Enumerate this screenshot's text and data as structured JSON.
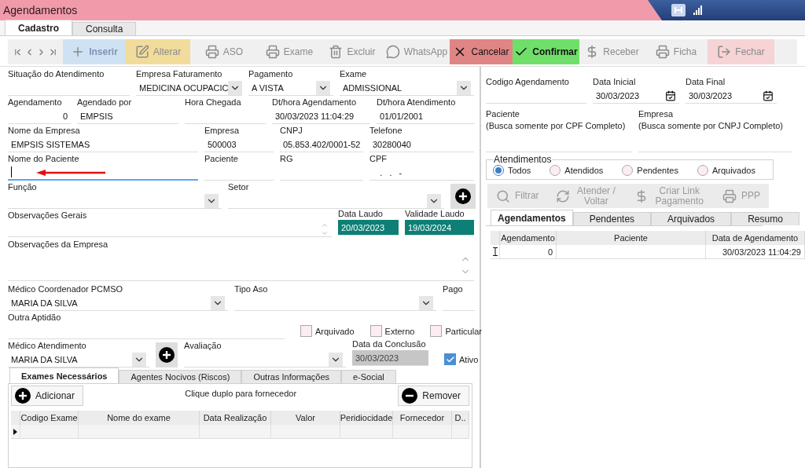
{
  "window": {
    "title": "Agendamentos"
  },
  "tabs": [
    {
      "label": "Cadastro",
      "selected": true
    },
    {
      "label": "Consulta",
      "selected": false
    }
  ],
  "toolbar": [
    {
      "label": "Inserir",
      "kind": "primary",
      "color": "#cfe2f3",
      "disabled": true
    },
    {
      "label": "Alterar",
      "kind": "normal",
      "color": "#f2dc9b",
      "disabled": true
    },
    {
      "label": "ASO",
      "kind": "normal",
      "disabled": true
    },
    {
      "label": "Exame",
      "kind": "normal",
      "disabled": true
    },
    {
      "label": "Excluir",
      "kind": "normal",
      "disabled": true
    },
    {
      "label": "WhatsApp",
      "kind": "normal",
      "disabled": true
    },
    {
      "label": "Cancelar",
      "kind": "normal",
      "color": "#e08585",
      "disabled": false
    },
    {
      "label": "Confirmar",
      "kind": "primary",
      "color": "#70df6a",
      "disabled": false
    },
    {
      "label": "Receber",
      "kind": "normal",
      "disabled": true
    },
    {
      "label": "Ficha",
      "kind": "normal",
      "disabled": true
    },
    {
      "label": "Fechar",
      "kind": "normal",
      "color": "#f6d3d5",
      "disabled": true
    }
  ],
  "form": [
    [
      {
        "label": "Situação do Atendimento",
        "kind": "text",
        "focused": false
      },
      {
        "label": "Empresa Faturamento",
        "value": "MEDICINA OCUPACIC",
        "kind": "select",
        "focused": false
      },
      {
        "label": "Pagamento",
        "value": "A VISTA",
        "kind": "select",
        "focused": false
      },
      {
        "label": "Exame",
        "value": "ADMISSIONAL",
        "kind": "select",
        "focused": false
      }
    ],
    [
      {
        "label": "Agendamento",
        "value": "0",
        "kind": "number",
        "focused": false
      },
      {
        "label": "Agendado por",
        "value": "EMPSIS",
        "kind": "text",
        "focused": false
      },
      {
        "label": "Hora Chegada",
        "kind": "text",
        "focused": false
      },
      {
        "label": "Dt/hora Agendamento",
        "value": "30/03/2023 11:04:29",
        "kind": "text",
        "focused": false
      },
      {
        "label": "Dt/hora Atendimento",
        "value": "01/01/2001",
        "kind": "text",
        "focused": false
      }
    ],
    [
      {
        "label": "Nome da Empresa",
        "value": "EMPSIS SISTEMAS",
        "kind": "text",
        "focused": false
      },
      {
        "label": "Empresa",
        "value": "500003",
        "kind": "text",
        "focused": false
      },
      {
        "label": "CNPJ",
        "value": "05.853.402/0001-52",
        "kind": "text",
        "focused": false
      },
      {
        "label": "Telefone",
        "value": "30280040",
        "kind": "text",
        "focused": false
      }
    ],
    [
      {
        "label": "Nome do Paciente",
        "kind": "text",
        "focused": true
      },
      {
        "label": "Paciente",
        "kind": "text",
        "focused": false
      },
      {
        "label": "RG",
        "kind": "text",
        "focused": false
      },
      {
        "label": "CPF",
        "value": "   .   .   -",
        "kind": "text",
        "focused": false
      }
    ],
    [
      {
        "label": "Função",
        "kind": "select",
        "focused": false
      },
      {
        "label": "Setor",
        "kind": "select",
        "focused": false
      },
      {
        "kind": "add"
      }
    ],
    [
      {
        "label": "Observações Gerais",
        "kind": "spin",
        "focused": false
      },
      {
        "label": "Data Laudo",
        "value": "20/03/2023",
        "kind": "date",
        "focused": false
      },
      {
        "label": "Validade Laudo",
        "value": "19/03/2024",
        "kind": "date",
        "focused": false
      }
    ],
    [
      {
        "label": "Observações da Empresa",
        "kind": "memo",
        "focused": false
      }
    ],
    [
      {
        "label": "Médico Coordenador PCMSO",
        "value": "MARIA DA SILVA",
        "kind": "select",
        "focused": false
      },
      {
        "label": "Tipo Aso",
        "kind": "select",
        "focused": false
      },
      {
        "label": "Pago",
        "kind": "text",
        "focused": false
      }
    ],
    [
      {
        "label": "Outra Aptidão",
        "kind": "text",
        "focused": false
      },
      {
        "label": "Arquivado",
        "kind": "check",
        "checked": false
      },
      {
        "label": "Externo",
        "kind": "check",
        "checked": false
      },
      {
        "label": "Particular",
        "kind": "check",
        "checked": false
      }
    ],
    [
      {
        "label": "Médico Atendimento",
        "value": "MARIA DA SILVA",
        "kind": "select",
        "focused": false
      },
      {
        "kind": "add"
      },
      {
        "label": "Avaliação",
        "kind": "select",
        "focused": false
      },
      {
        "label": "Data da Conclusão",
        "value": "30/03/2023",
        "kind": "readonly",
        "focused": false
      },
      {
        "label": "Ativo",
        "kind": "check",
        "checked": true
      }
    ]
  ],
  "exam_tabs": [
    {
      "label": "Exames Necessários",
      "selected": true
    },
    {
      "label": "Agentes Nocivos (Riscos)",
      "selected": false
    },
    {
      "label": "Outras Informações",
      "selected": false
    },
    {
      "label": "e-Social",
      "selected": false
    }
  ],
  "exams": {
    "add_label": "Adicionar",
    "hint": "Clique duplo para fornecedor",
    "remove_label": "Remover",
    "columns": [
      "Codigo Exame",
      "Nome do exame",
      "Data Realização",
      "Valor",
      "Peridiocidade",
      "Fornecedor",
      "D.."
    ],
    "rows": [
      {
        "editing": false,
        "cells": [
          null,
          null,
          null,
          null,
          null,
          null,
          null
        ]
      }
    ]
  },
  "search": [
    [
      {
        "label": "Codigo Agendamento",
        "kind": "text"
      },
      {
        "label": "Data Inicial",
        "value": "30/03/2023",
        "kind": "calendar"
      },
      {
        "label": "Data Final",
        "value": "30/03/2023",
        "kind": "calendar"
      }
    ],
    [
      {
        "label": "Paciente",
        "note": "(Busca somente por CPF Completo)",
        "kind": "text"
      },
      {
        "label": "Empresa",
        "note": "(Busca somente por CNPJ Completo)",
        "kind": "text"
      }
    ]
  ],
  "attendance": {
    "title": "Atendimentos",
    "options": [
      {
        "label": "Todos",
        "selected": true
      },
      {
        "label": "Atendidos",
        "selected": false
      },
      {
        "label": "Pendentes",
        "selected": false
      },
      {
        "label": "Arquivados",
        "selected": false
      }
    ]
  },
  "actions": [
    {
      "label": "Filtrar",
      "disabled": true
    },
    {
      "label": "Atender / Voltar",
      "disabled": true
    },
    {
      "label": "Criar Link Pagamento",
      "disabled": true
    },
    {
      "label": "PPP",
      "disabled": true
    }
  ],
  "result_tabs": [
    {
      "label": "Agendamentos",
      "selected": true
    },
    {
      "label": "Pendentes",
      "selected": false
    },
    {
      "label": "Arquivados",
      "selected": false
    },
    {
      "label": "Resumo",
      "selected": false
    }
  ],
  "results": {
    "columns": [
      "Agendamento",
      "Paciente",
      "Data de Agendamento"
    ],
    "rows": [
      {
        "editing": true,
        "cells": [
          "0",
          null,
          "30/03/2023 11:04:29"
        ]
      }
    ]
  }
}
